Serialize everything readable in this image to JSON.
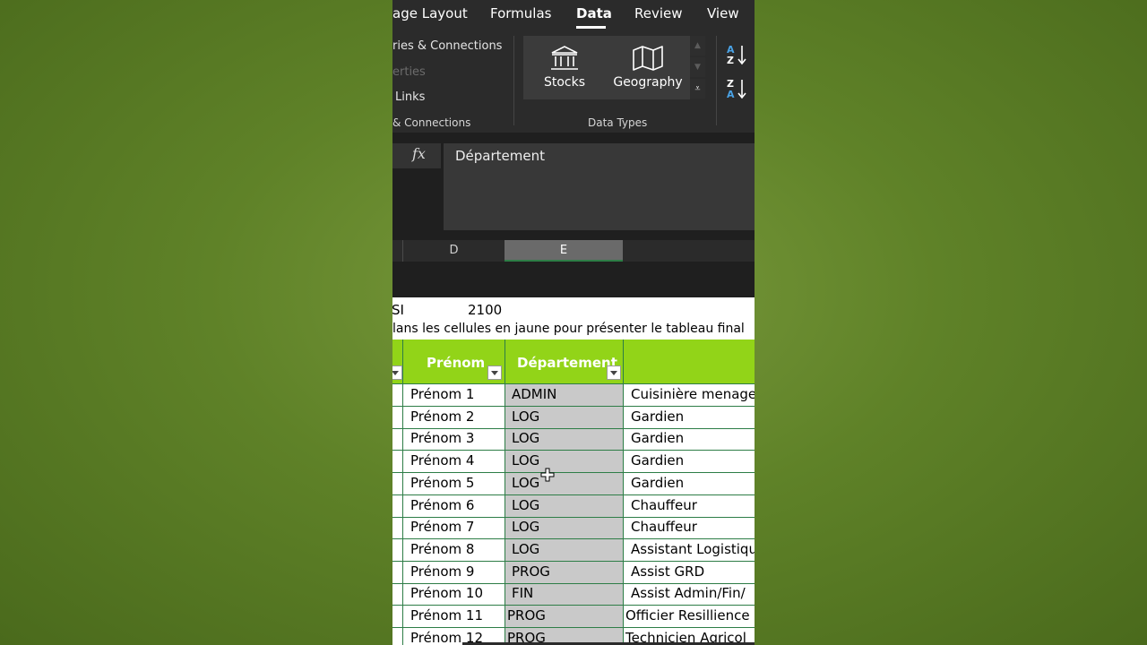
{
  "ribbon": {
    "tabs": [
      "age Layout",
      "Formulas",
      "Data",
      "Review",
      "View"
    ],
    "active_tab": "Data",
    "queries_group": {
      "items": [
        "ries & Connections",
        "erties",
        "Links"
      ],
      "label": "& Connections"
    },
    "data_types": {
      "stocks": "Stocks",
      "geography": "Geography",
      "label": "Data Types"
    }
  },
  "formula_bar": {
    "fx": "fx",
    "content": "Département"
  },
  "column_headers": [
    "D",
    "E"
  ],
  "sheet": {
    "row_partial_label": "SI",
    "row_value": "2100",
    "instruction": "lans les cellules en jaune pour présenter le tableau final",
    "table_headers": {
      "prenom": "Prénom",
      "departement": "Département"
    },
    "rows": [
      {
        "prenom": "Prénom 1",
        "dept": "ADMIN",
        "poste": "Cuisinière menage"
      },
      {
        "prenom": "Prénom 2",
        "dept": "LOG",
        "poste": "Gardien"
      },
      {
        "prenom": "Prénom 3",
        "dept": "LOG",
        "poste": "Gardien"
      },
      {
        "prenom": "Prénom 4",
        "dept": "LOG",
        "poste": "Gardien"
      },
      {
        "prenom": "Prénom 5",
        "dept": "LOG",
        "poste": "Gardien"
      },
      {
        "prenom": "Prénom 6",
        "dept": "LOG",
        "poste": "Chauffeur"
      },
      {
        "prenom": "Prénom 7",
        "dept": "LOG",
        "poste": "Chauffeur"
      },
      {
        "prenom": "Prénom 8",
        "dept": "LOG",
        "poste": "Assistant Logistiqu"
      },
      {
        "prenom": "Prénom 9",
        "dept": "PROG",
        "poste": "Assist GRD"
      },
      {
        "prenom": "Prénom 10",
        "dept": "FIN",
        "poste": "Assist Admin/Fin/"
      },
      {
        "prenom": "Prénom 11",
        "dept": "PROG",
        "poste": "Officier  Resillience"
      },
      {
        "prenom": "Prénom 12",
        "dept": "PROG",
        "poste": "Technicien Agricol"
      }
    ]
  },
  "colors": {
    "header_green": "#92d418",
    "ribbon_dark": "#2b2b2b",
    "selected_column_gray": "#c9c9c9",
    "gridline_green": "#2d7d46",
    "background_green": "#5f8228"
  }
}
